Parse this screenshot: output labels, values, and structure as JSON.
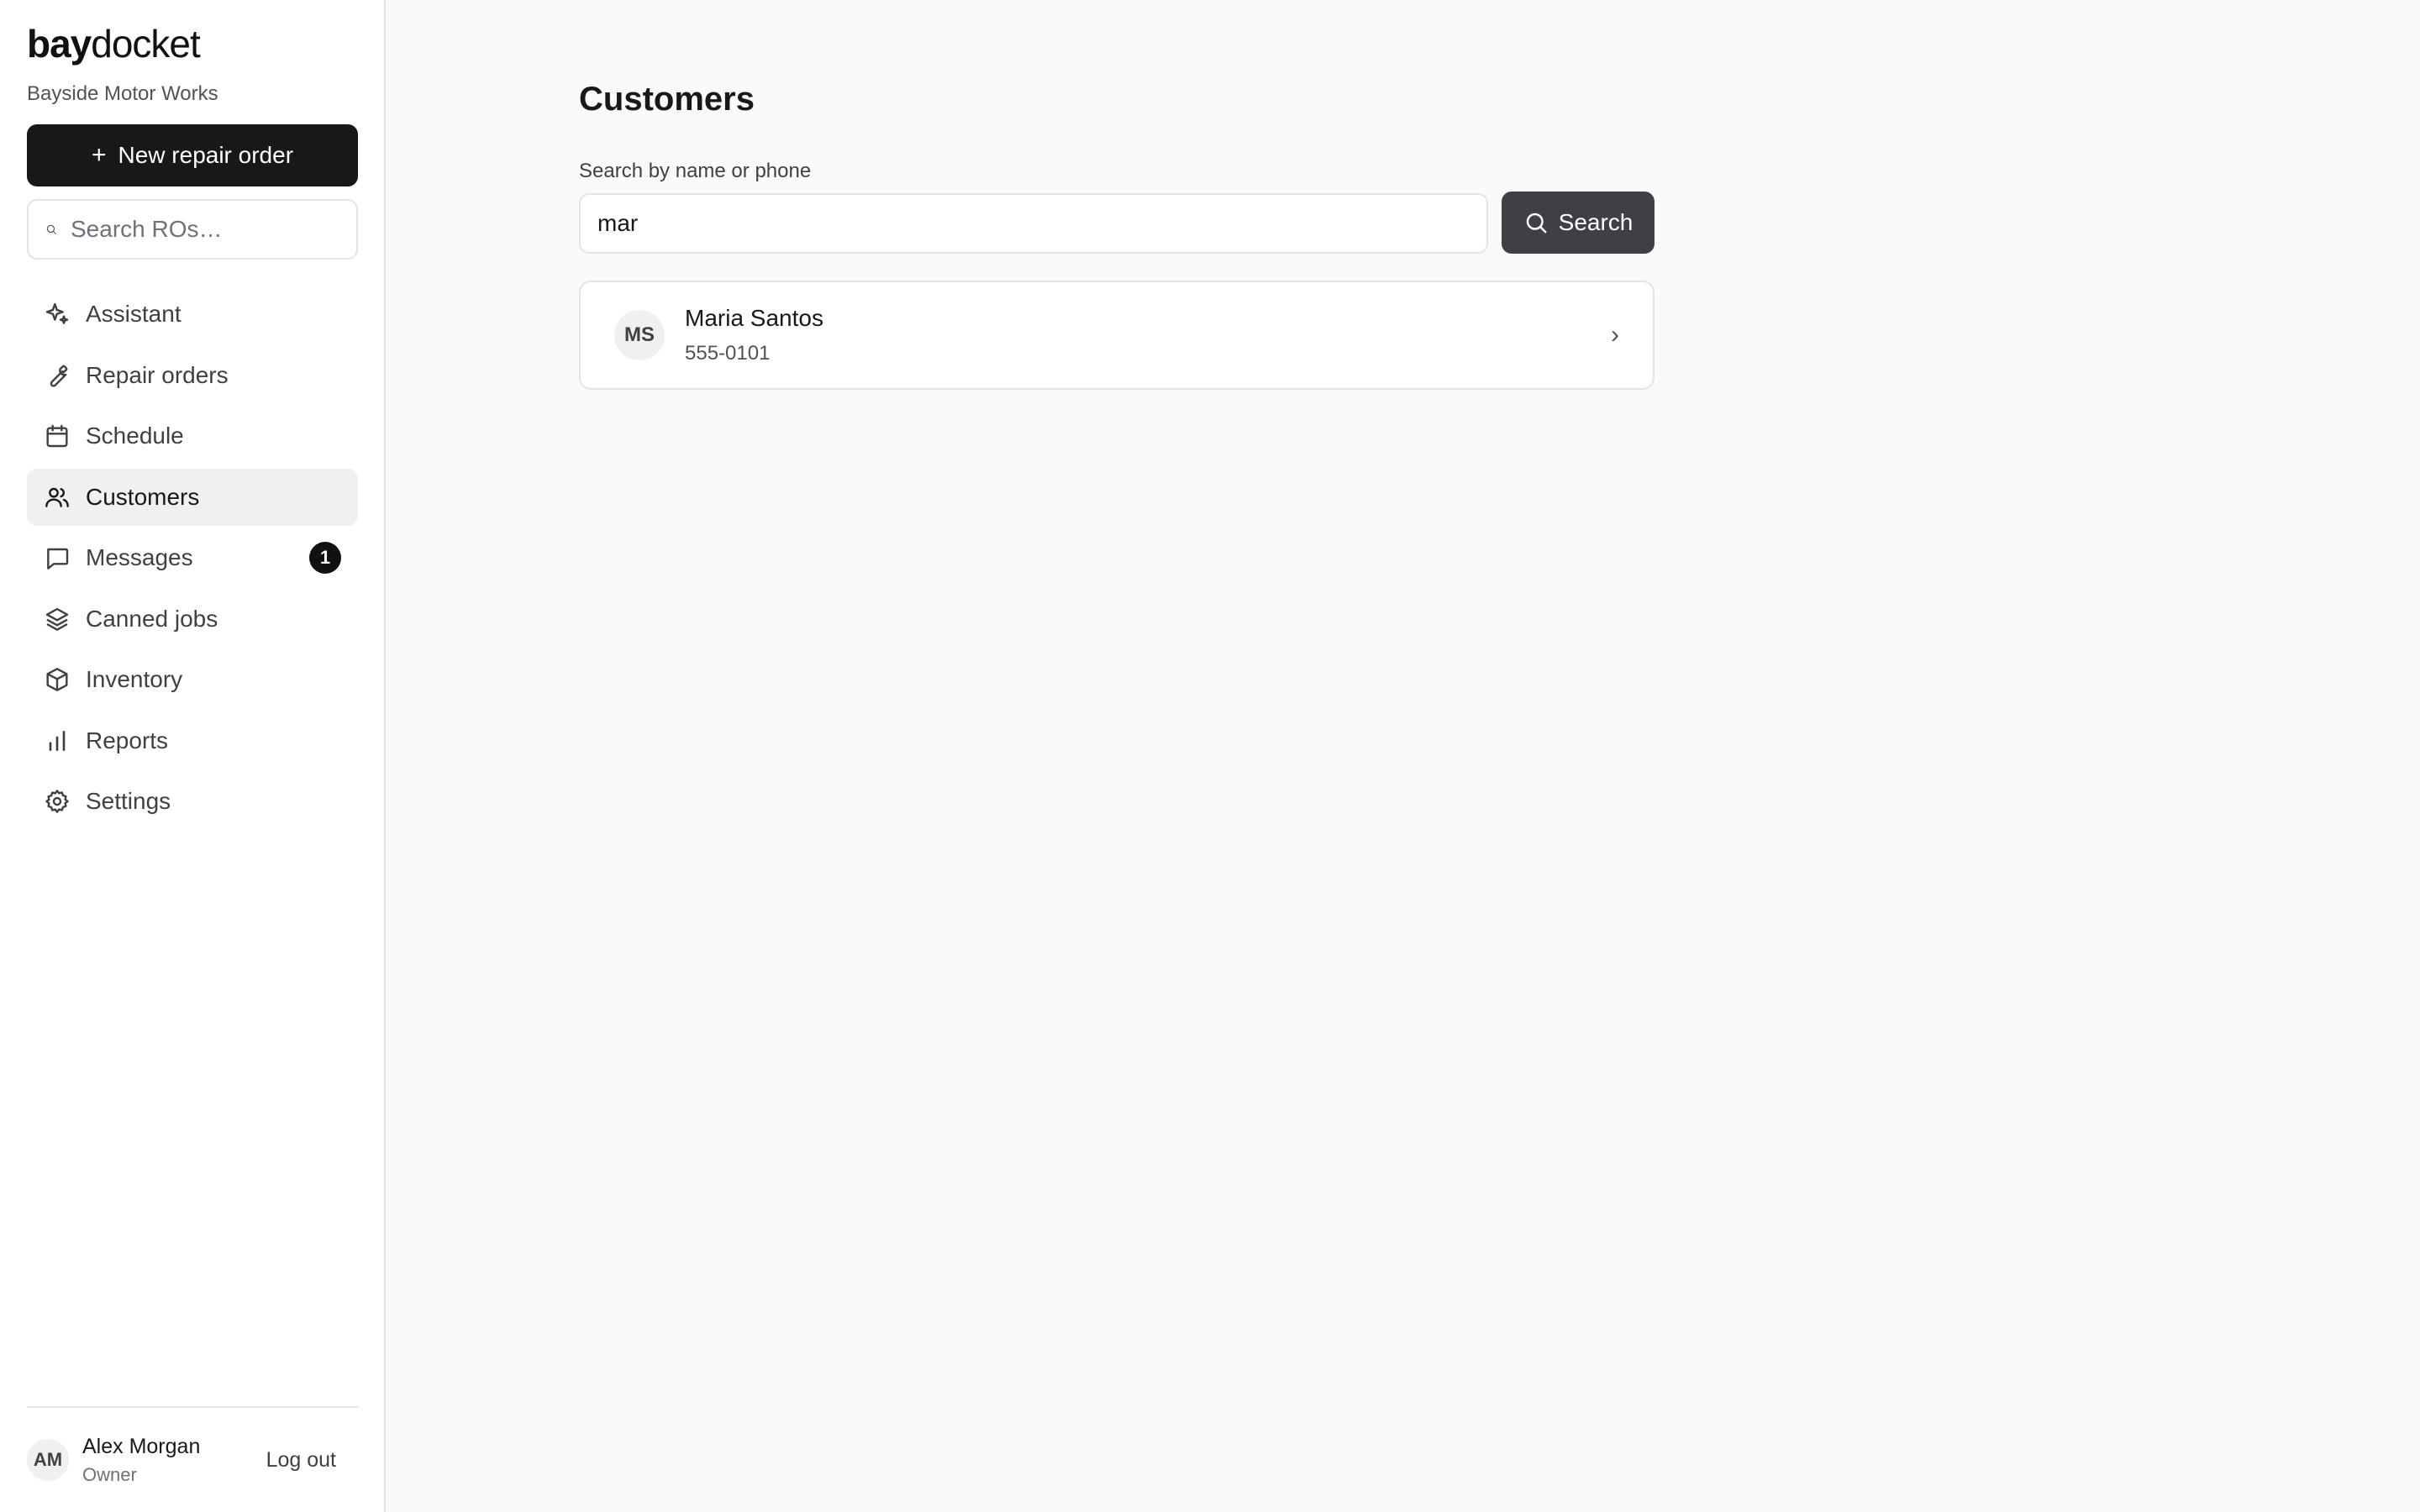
{
  "brand": {
    "bold": "bay",
    "light": "docket",
    "shop_name": "Bayside Motor Works"
  },
  "sidebar": {
    "new_ro_label": "New repair order",
    "search_placeholder": "Search ROs…",
    "items": [
      {
        "label": "Assistant",
        "icon": "sparkle-icon"
      },
      {
        "label": "Repair orders",
        "icon": "wrench-icon"
      },
      {
        "label": "Schedule",
        "icon": "calendar-icon"
      },
      {
        "label": "Customers",
        "icon": "users-icon",
        "active": true
      },
      {
        "label": "Messages",
        "icon": "message-icon",
        "badge": "1"
      },
      {
        "label": "Canned jobs",
        "icon": "layers-icon"
      },
      {
        "label": "Inventory",
        "icon": "box-icon"
      },
      {
        "label": "Reports",
        "icon": "bar-chart-icon"
      },
      {
        "label": "Settings",
        "icon": "gear-icon"
      }
    ]
  },
  "user": {
    "initials": "AM",
    "name": "Alex Morgan",
    "role": "Owner",
    "logout_label": "Log out"
  },
  "main": {
    "title": "Customers",
    "search_label": "Search by name or phone",
    "search_value": "mar",
    "search_button": "Search",
    "results": [
      {
        "initials": "MS",
        "name": "Maria Santos",
        "phone": "555-0101"
      }
    ]
  },
  "colors": {
    "primary": "#18181b",
    "search_button": "#3f3f46",
    "active_nav": "#f0f0f1",
    "background": "#fafafa"
  }
}
